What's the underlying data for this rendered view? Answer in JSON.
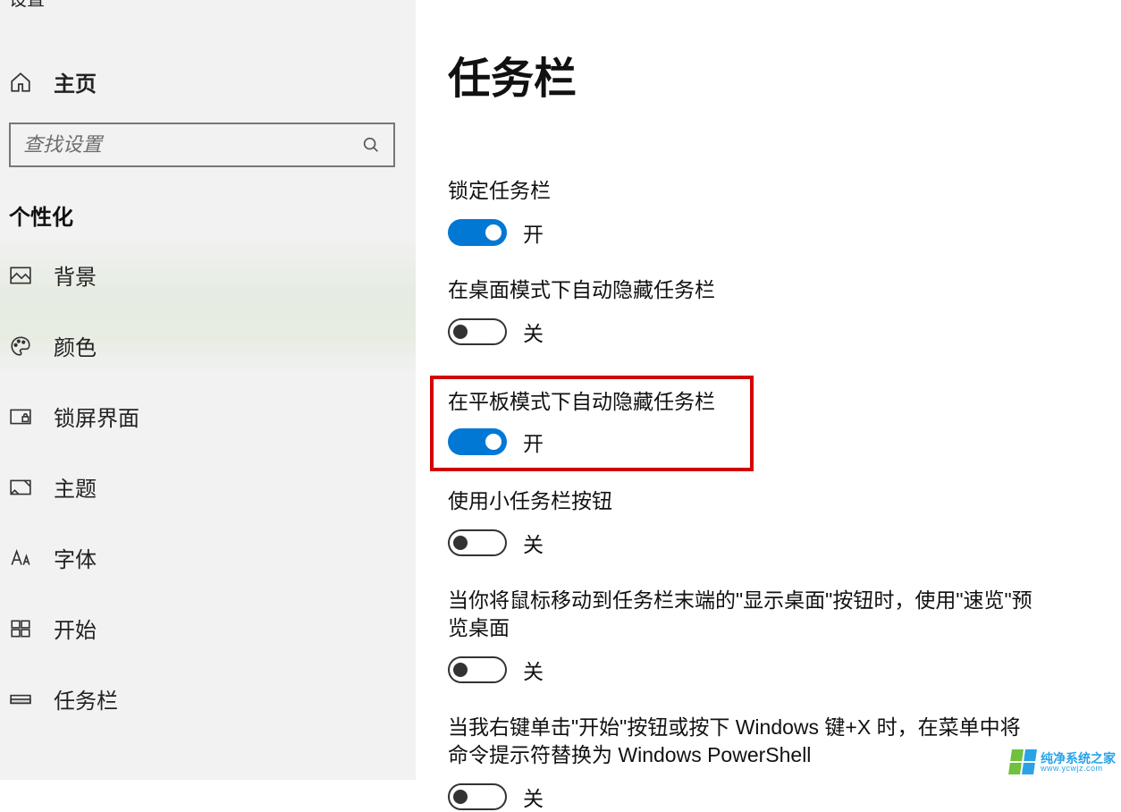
{
  "sidebar": {
    "top_trunc": "设置",
    "home_label": "主页",
    "search_placeholder": "查找设置",
    "category": "个性化",
    "items": [
      {
        "label": "背景",
        "icon": "picture-icon"
      },
      {
        "label": "颜色",
        "icon": "palette-icon"
      },
      {
        "label": "锁屏界面",
        "icon": "lockscreen-icon"
      },
      {
        "label": "主题",
        "icon": "theme-icon"
      },
      {
        "label": "字体",
        "icon": "font-icon"
      },
      {
        "label": "开始",
        "icon": "start-icon"
      },
      {
        "label": "任务栏",
        "icon": "taskbar-icon"
      }
    ]
  },
  "main": {
    "title": "任务栏",
    "toggle_on_text": "开",
    "toggle_off_text": "关",
    "settings": [
      {
        "label": "锁定任务栏",
        "on": true,
        "highlight": false
      },
      {
        "label": "在桌面模式下自动隐藏任务栏",
        "on": false,
        "highlight": false
      },
      {
        "label": "在平板模式下自动隐藏任务栏",
        "on": true,
        "highlight": true
      },
      {
        "label": "使用小任务栏按钮",
        "on": false,
        "highlight": false
      },
      {
        "label": "当你将鼠标移动到任务栏末端的\"显示桌面\"按钮时，使用\"速览\"预览桌面",
        "on": false,
        "highlight": false
      },
      {
        "label": "当我右键单击\"开始\"按钮或按下 Windows 键+X 时，在菜单中将命令提示符替换为 Windows PowerShell",
        "on": false,
        "highlight": false
      }
    ]
  },
  "watermark": {
    "line1": "纯净系统之家",
    "line2": "www.ycwjz.com"
  },
  "colors": {
    "accent": "#0078d4",
    "highlight": "#d40000"
  }
}
